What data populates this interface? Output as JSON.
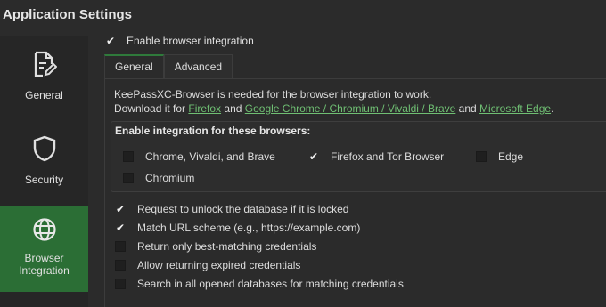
{
  "window": {
    "title": "Application Settings"
  },
  "sidebar": {
    "items": [
      {
        "label": "General",
        "icon": "document-edit-icon",
        "active": false
      },
      {
        "label": "Security",
        "icon": "shield-icon",
        "active": false
      },
      {
        "label": "Browser Integration",
        "icon": "globe-icon",
        "active": true
      }
    ],
    "active_color": "#2b6e35"
  },
  "main": {
    "enable_browser_integration": {
      "label": "Enable browser integration",
      "checked": true
    },
    "tabs": [
      {
        "label": "General",
        "active": true
      },
      {
        "label": "Advanced",
        "active": false
      }
    ],
    "info": {
      "line1": "KeePassXC-Browser is needed for the browser integration to work.",
      "line2_prefix": "Download it for ",
      "link_firefox": "Firefox",
      "and1": " and ",
      "link_chrome": "Google Chrome / Chromium / Vivaldi / Brave",
      "and2": " and ",
      "link_edge": "Microsoft Edge",
      "suffix": ".",
      "link_color": "#6fbf73"
    },
    "browsers_group": {
      "title": "Enable integration for these browsers:",
      "chrome": {
        "label": "Chrome, Vivaldi, and Brave",
        "checked": false
      },
      "firefox": {
        "label": "Firefox and Tor Browser",
        "checked": true
      },
      "edge": {
        "label": "Edge",
        "checked": false
      },
      "chromium": {
        "label": "Chromium",
        "checked": false
      }
    },
    "options": {
      "unlock": {
        "label": "Request to unlock the database if it is locked",
        "checked": true
      },
      "match_scheme": {
        "label": "Match URL scheme (e.g., https://example.com)",
        "checked": true
      },
      "best_matching": {
        "label": "Return only best-matching credentials",
        "checked": false
      },
      "expired": {
        "label": "Allow returning expired credentials",
        "checked": false
      },
      "search_all": {
        "label": "Search in all opened databases for matching credentials",
        "checked": false
      }
    }
  }
}
